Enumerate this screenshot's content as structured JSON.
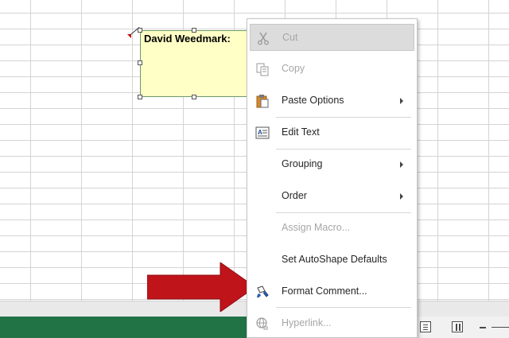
{
  "comment": {
    "author": "David Weedmark:"
  },
  "context_menu": {
    "items": [
      {
        "label": "Cut",
        "icon": "scissors-icon",
        "disabled": true,
        "highlight": true
      },
      {
        "label": "Copy",
        "icon": "copy-icon",
        "disabled": true
      },
      {
        "label": "Paste Options",
        "icon": "clipboard-icon",
        "submenu": true
      },
      {
        "label": "Edit Text",
        "icon": "edit-text-icon"
      },
      {
        "label": "Grouping",
        "submenu": true
      },
      {
        "label": "Order",
        "submenu": true
      },
      {
        "label": "Assign Macro...",
        "disabled": true
      },
      {
        "label": "Set AutoShape Defaults"
      },
      {
        "label": "Format Comment...",
        "icon": "format-paint-icon"
      },
      {
        "label": "Hyperlink...",
        "icon": "globe-link-icon",
        "disabled": true
      }
    ]
  },
  "colors": {
    "status_bar": "#217346",
    "comment_fill": "#ffffc6",
    "arrow": "#c0141b"
  }
}
